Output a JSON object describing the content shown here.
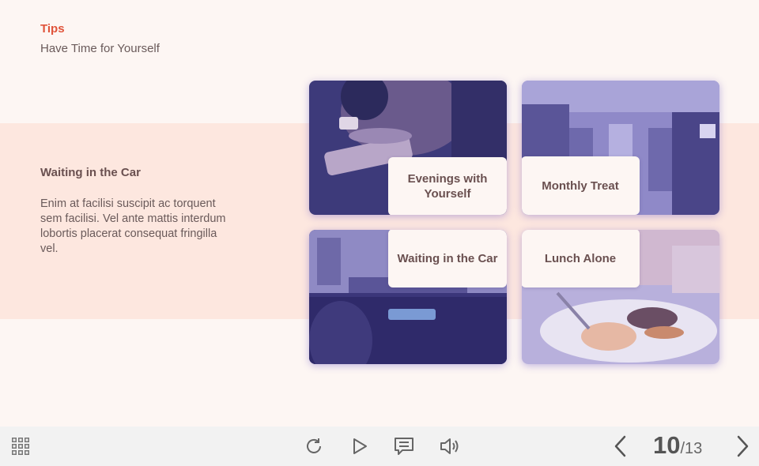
{
  "header": {
    "tips_label": "Tips",
    "subtitle": "Have Time for Yourself"
  },
  "content": {
    "title": "Waiting in the Car",
    "body": "Enim at facilisi suscipit ac torquent sem facilisi. Vel ante mattis interdum lobortis placerat consequat fringilla vel."
  },
  "cards": [
    {
      "label": "Evenings with Yourself"
    },
    {
      "label": "Monthly Treat"
    },
    {
      "label": "Waiting in the Car"
    },
    {
      "label": "Lunch Alone"
    }
  ],
  "toolbar": {
    "menu_icon": "grid-menu-icon",
    "replay_icon": "replay-icon",
    "play_icon": "play-icon",
    "notes_icon": "notes-icon",
    "volume_icon": "volume-icon",
    "prev_icon": "chevron-left-icon",
    "next_icon": "chevron-right-icon"
  },
  "pagination": {
    "current": "10",
    "separator": "/",
    "total": "13"
  },
  "colors": {
    "accent": "#e0533a",
    "band": "#fde7df",
    "overlay": "#3f3a80",
    "text": "#6a5050"
  }
}
